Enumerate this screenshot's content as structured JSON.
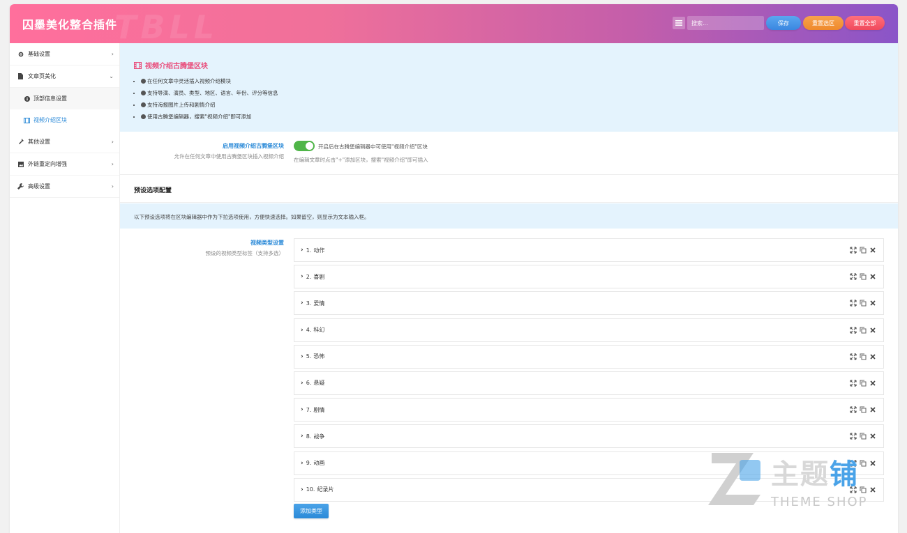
{
  "header": {
    "title": "囚墨美化整合插件",
    "watermark": "TBLL",
    "search_placeholder": "搜索...",
    "save_label": "保存",
    "reset_section_label": "重置选区",
    "reset_all_label": "重置全部"
  },
  "sidebar": {
    "items": [
      {
        "label": "基础设置",
        "icon": "gear-icon"
      },
      {
        "label": "文章页美化",
        "icon": "file-icon"
      },
      {
        "label": "其他设置",
        "icon": "pin-icon"
      },
      {
        "label": "外链重定向增强",
        "icon": "image-icon"
      },
      {
        "label": "高级设置",
        "icon": "wrench-icon"
      }
    ],
    "sub_items": [
      {
        "label": "顶部信息设置",
        "icon": "info-icon"
      },
      {
        "label": "视频介绍区块",
        "icon": "film-icon"
      }
    ]
  },
  "intro": {
    "title": "视频介绍古腾堡区块",
    "bullets": [
      "在任何文章中灵活插入视频介绍模块",
      "支持导演、演员、类型、地区、语言、年份、评分等信息",
      "支持海报图片上传和剧情介绍",
      "使用古腾堡编辑器，搜索\"视频介绍\"即可添加"
    ]
  },
  "enable": {
    "title": "启用视频介绍古腾堡区块",
    "desc": "允许在任何文章中使用古腾堡区块插入视频介绍",
    "toggle_text": "开启后在古腾堡编辑器中可使用\"视频介绍\"区块",
    "help": "在编辑文章时点击\"+\"添加区块，搜索\"视频介绍\"即可插入"
  },
  "section": {
    "title": "预设选项配置",
    "notice": "以下预设选项将在区块编辑器中作为下拉选项使用，方便快速选择。如果留空，则显示为文本输入框。"
  },
  "types": {
    "title": "视频类型设置",
    "desc": "预设的视频类型标签（支持多选）",
    "items": [
      {
        "num": "1.",
        "label": "动作"
      },
      {
        "num": "2.",
        "label": "喜剧"
      },
      {
        "num": "3.",
        "label": "爱情"
      },
      {
        "num": "4.",
        "label": "科幻"
      },
      {
        "num": "5.",
        "label": "恐怖"
      },
      {
        "num": "6.",
        "label": "悬疑"
      },
      {
        "num": "7.",
        "label": "剧情"
      },
      {
        "num": "8.",
        "label": "战争"
      },
      {
        "num": "9.",
        "label": "动画"
      },
      {
        "num": "10.",
        "label": "纪录片"
      }
    ],
    "add_label": "添加类型"
  },
  "watermark": {
    "text_grey": "主题",
    "text_blue": "铺",
    "sub": "THEME SHOP"
  },
  "colors": {
    "accent_blue": "#2b8ad8",
    "intro_title": "#e94b7a",
    "toggle_on": "#4fb548",
    "info_bg": "#e4f3fd"
  }
}
